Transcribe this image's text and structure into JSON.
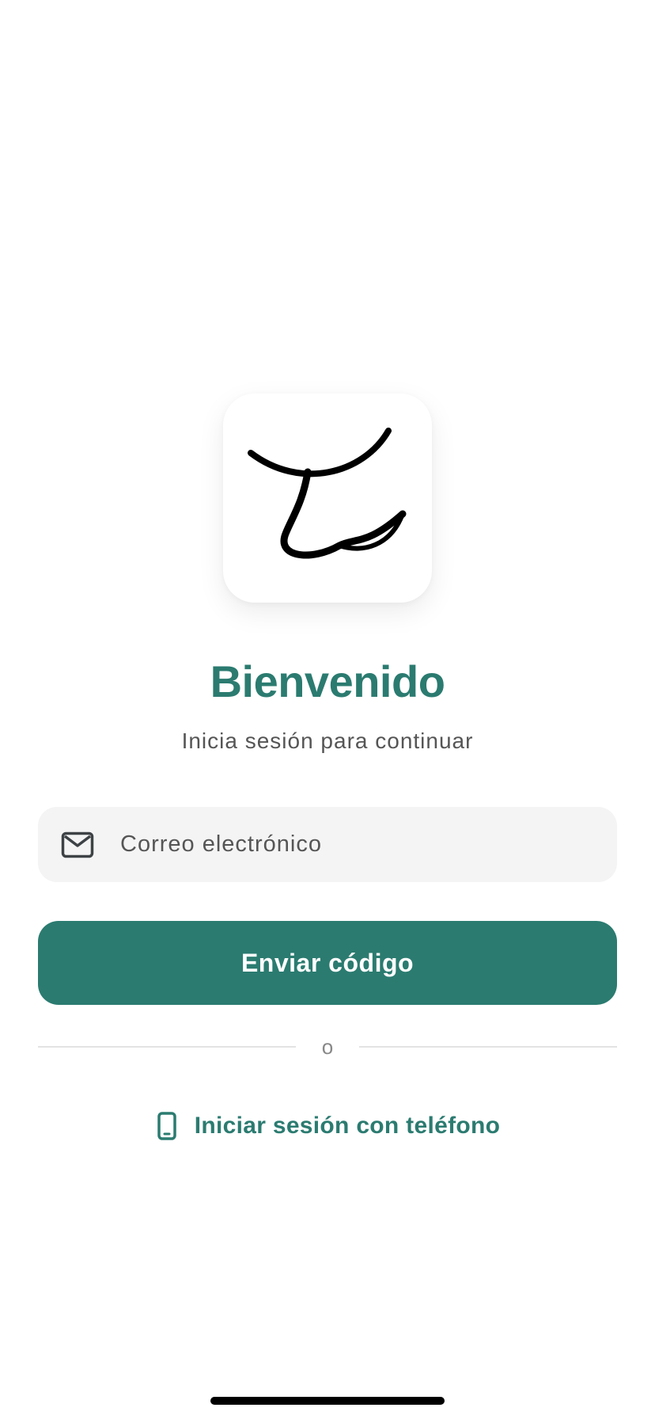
{
  "logo": {
    "icon": "handwritten-t-logo"
  },
  "header": {
    "title": "Bienvenido",
    "subtitle": "Inicia sesión para continuar"
  },
  "email": {
    "icon": "mail-icon",
    "placeholder": "Correo electrónico",
    "value": ""
  },
  "actions": {
    "send_code_label": "Enviar código",
    "separator_label": "o",
    "phone_login_label": "Iniciar sesión con teléfono",
    "phone_icon": "phone-icon"
  },
  "colors": {
    "accent": "#2b7b70",
    "field_background": "#f4f4f4",
    "text_muted": "#555555"
  }
}
